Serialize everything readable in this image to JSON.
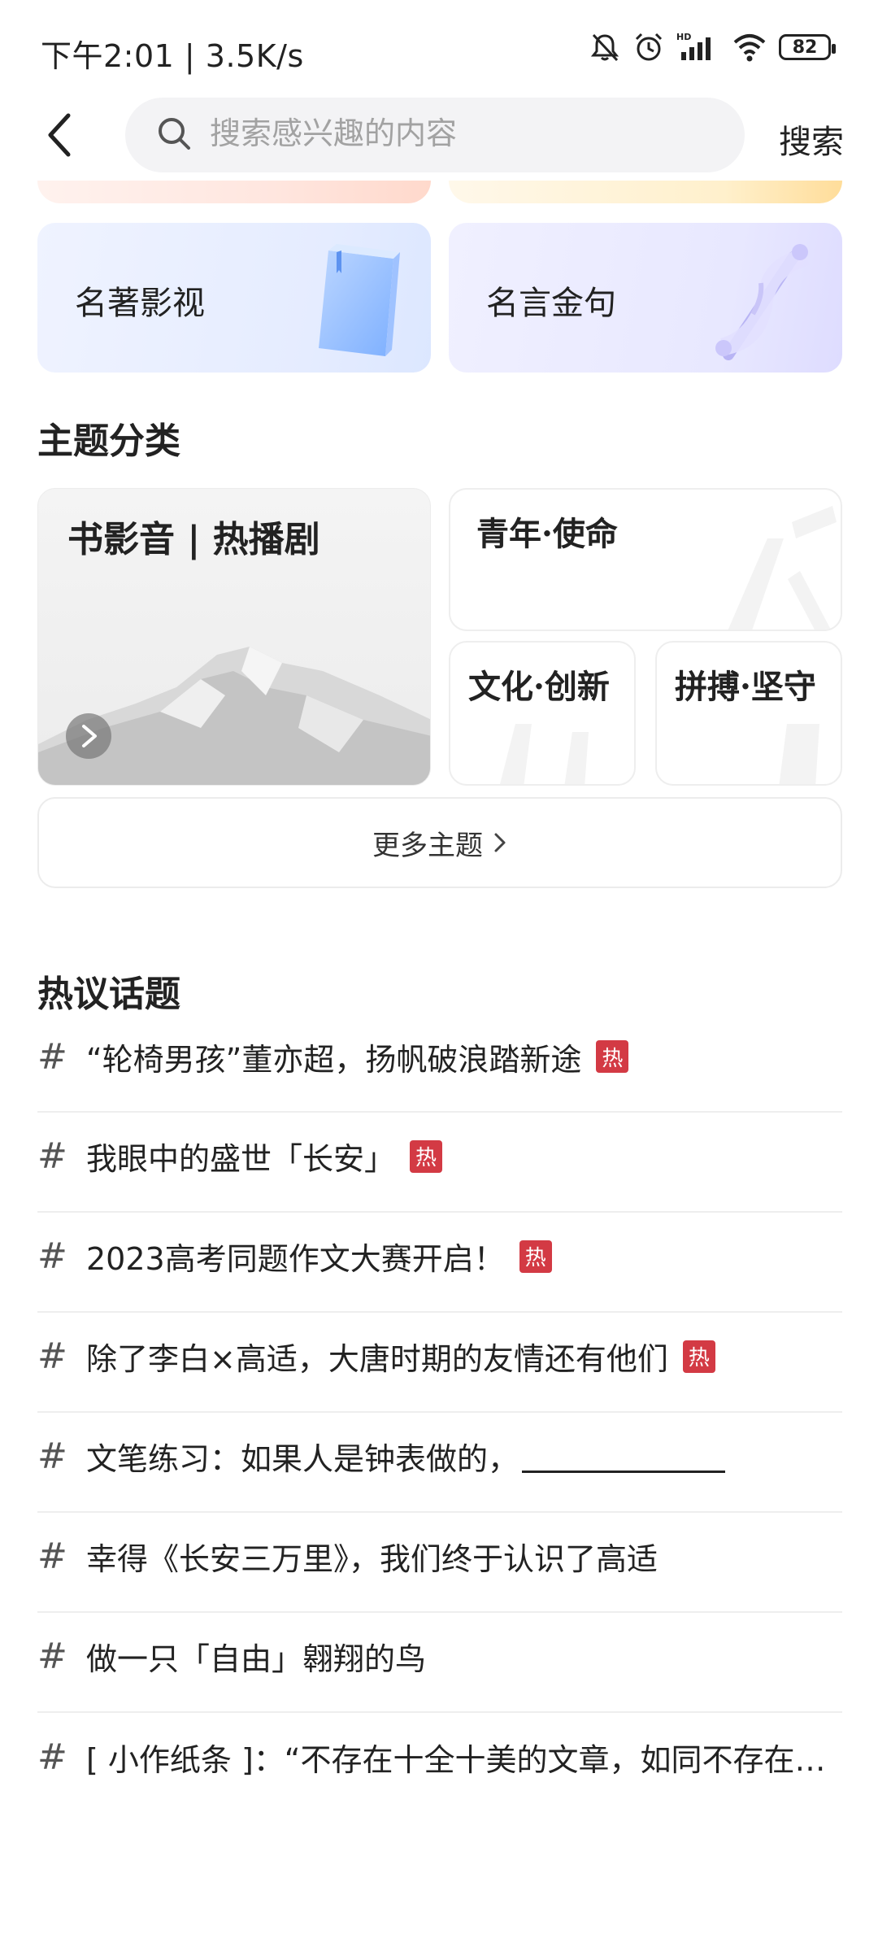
{
  "status_bar": {
    "time_speed": "下午2:01 | 3.5K/s",
    "battery": "82"
  },
  "header": {
    "search_placeholder": "搜索感兴趣的内容",
    "search_button": "搜索"
  },
  "categories": [
    {
      "label": "名著影视"
    },
    {
      "label": "名言金句"
    }
  ],
  "themes": {
    "title": "主题分类",
    "big": "书影音 | 热播剧",
    "small": [
      "青年·使命",
      "文化·创新",
      "拼搏·坚守"
    ],
    "more": "更多主题"
  },
  "hot_topics": {
    "title": "热议话题",
    "hot_label": "热",
    "items": [
      {
        "text": "“轮椅男孩”董亦超，扬帆破浪踏新途",
        "hot": true
      },
      {
        "text": "我眼中的盛世「长安」",
        "hot": true
      },
      {
        "text": "2023高考同题作文大赛开启！",
        "hot": true
      },
      {
        "text": "除了李白×高适，大唐时期的友情还有他们",
        "hot": true
      },
      {
        "text": "文笔练习：如果人是钟表做的，",
        "hot": false
      },
      {
        "text": "幸得《长安三万里》，我们终于认识了高适",
        "hot": false
      },
      {
        "text": "做一只「自由」翱翔的鸟",
        "hot": false
      },
      {
        "text": "[ 小作纸条 ]：“不存在十全十美的文章，如同不存在绝对的绝望”",
        "hot": false
      }
    ]
  }
}
